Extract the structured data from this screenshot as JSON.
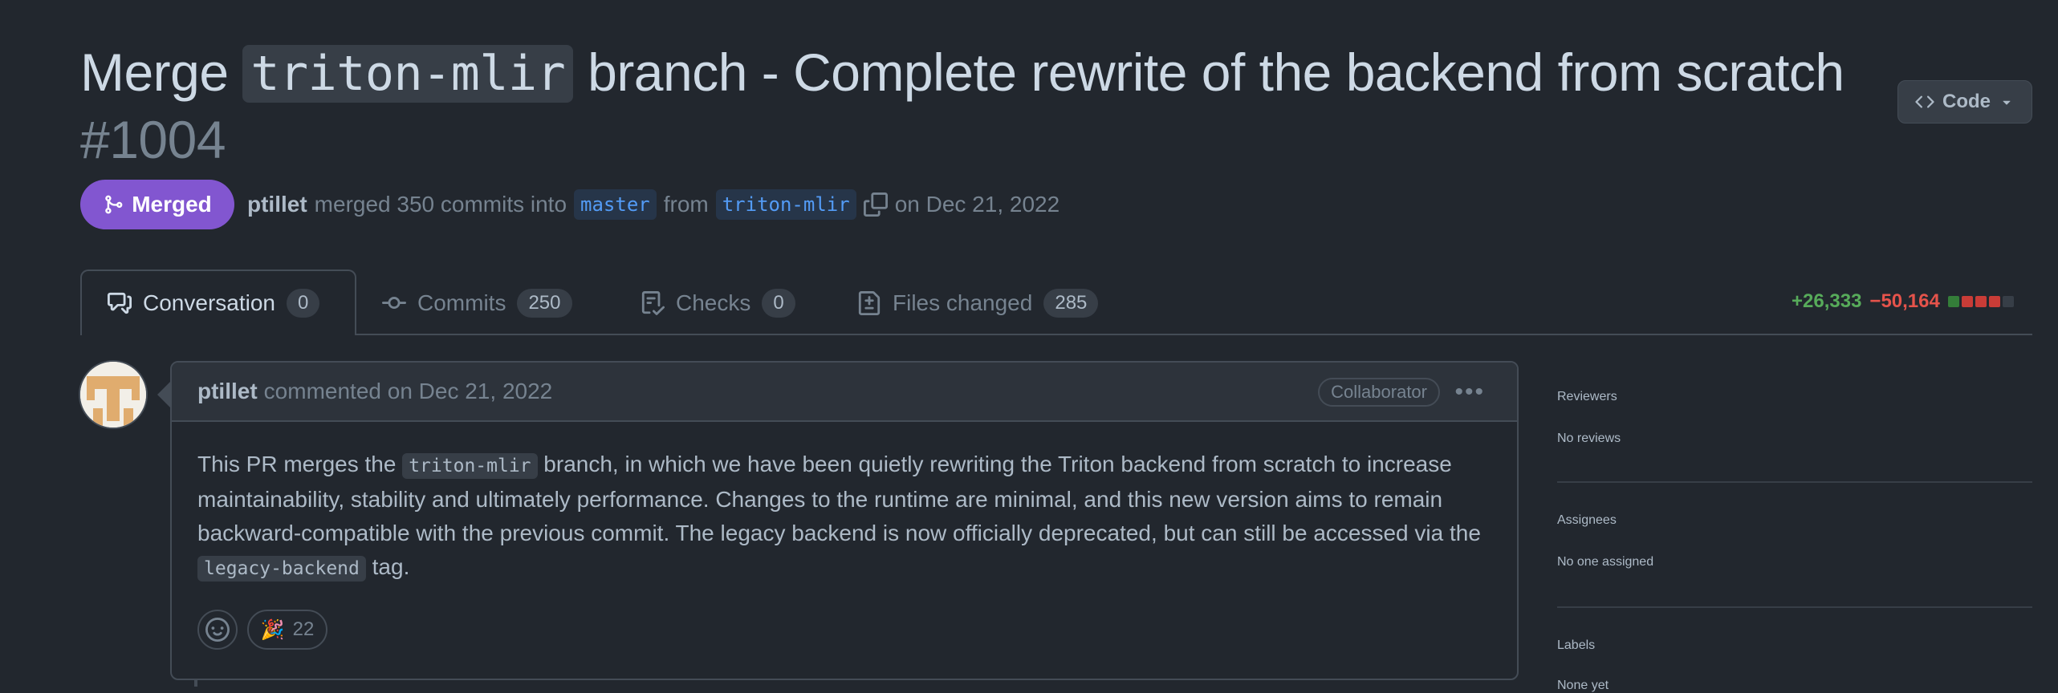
{
  "pr": {
    "title_pre": "Merge ",
    "title_code": "triton-mlir",
    "title_post": " branch - Complete rewrite of the backend from scratch",
    "number": "#1004",
    "code_button": "Code",
    "state": "Merged",
    "author": "ptillet",
    "merged_text": "merged 350 commits into",
    "base_branch": "master",
    "from_text": "from",
    "head_branch": "triton-mlir",
    "date_text": "on Dec 21, 2022"
  },
  "tabs": [
    {
      "label": "Conversation",
      "count": "0"
    },
    {
      "label": "Commits",
      "count": "250"
    },
    {
      "label": "Checks",
      "count": "0"
    },
    {
      "label": "Files changed",
      "count": "285"
    }
  ],
  "diffstat": {
    "additions": "+26,333",
    "deletions": "−50,164"
  },
  "diff_blocks": [
    "#347d39",
    "#c93c37",
    "#c93c37",
    "#c93c37",
    "#373e47"
  ],
  "comment": {
    "author": "ptillet",
    "action": "commented on Dec 21, 2022",
    "role": "Collaborator",
    "body_1": "This PR merges the ",
    "code_1": "triton-mlir",
    "body_2": " branch, in which we have been quietly rewriting the Triton backend from scratch to increase maintainability, stability and ultimately performance. Changes to the runtime are minimal, and this new version aims to remain backward-compatible with the previous commit. The legacy backend is now officially deprecated, but can still be accessed via the ",
    "code_2": "legacy-backend",
    "body_3": " tag.",
    "reaction_emoji": "🎉",
    "reaction_count": "22"
  },
  "sidebar": {
    "reviewers_title": "Reviewers",
    "reviewers_value": "No reviews",
    "assignees_title": "Assignees",
    "assignees_value": "No one assigned",
    "labels_title": "Labels",
    "labels_value": "None yet"
  },
  "colors": {
    "merged": "#8256d0",
    "additions": "#57ab5a",
    "deletions": "#e5534b",
    "branch": "#539bf5"
  }
}
